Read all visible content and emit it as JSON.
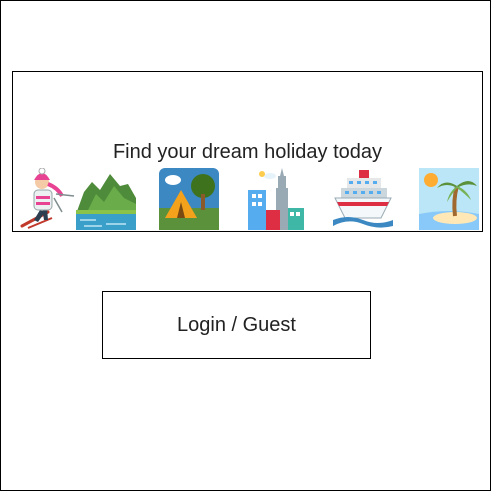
{
  "banner": {
    "tagline": "Find your dream holiday today",
    "icons": [
      "skier-icon",
      "mountain-lake-icon",
      "camping-tent-icon",
      "cityscape-icon",
      "cruise-ship-icon",
      "desert-island-icon"
    ]
  },
  "login": {
    "label": "Login / Guest"
  }
}
